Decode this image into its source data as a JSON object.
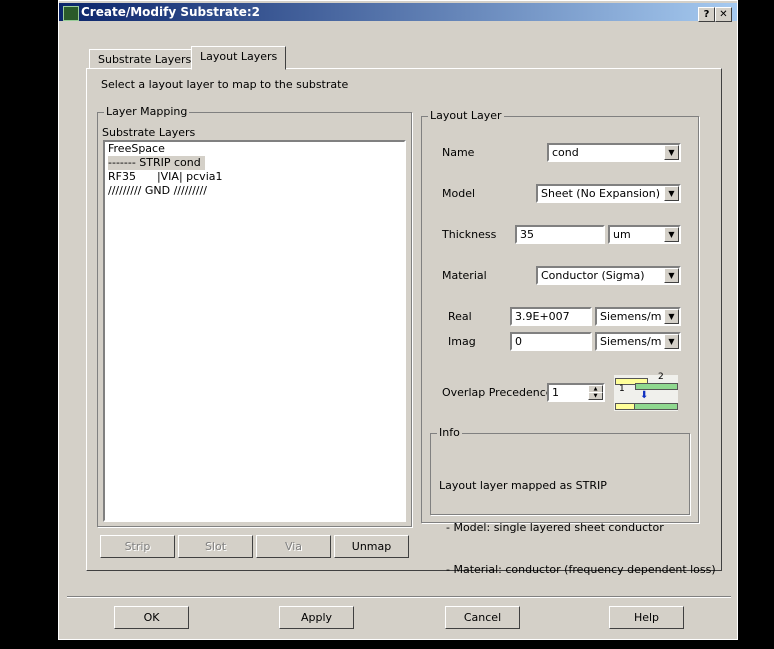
{
  "window": {
    "title": "Create/Modify Substrate:2",
    "help_btn": "?",
    "close_btn": "✕"
  },
  "tabs": [
    {
      "label": "Substrate Layers"
    },
    {
      "label": "Layout Layers"
    }
  ],
  "instruction": "Select a layout layer to map to the substrate",
  "layer_mapping": {
    "group": "Layer Mapping",
    "list_label": "Substrate Layers",
    "items": [
      "FreeSpace",
      "------- STRIP cond",
      "RF35      |VIA| pcvia1",
      "///////// GND /////////"
    ],
    "buttons": {
      "strip": "Strip",
      "slot": "Slot",
      "via": "Via",
      "unmap": "Unmap"
    }
  },
  "layout_layer": {
    "group": "Layout Layer",
    "name_label": "Name",
    "name_value": "cond",
    "model_label": "Model",
    "model_value": "Sheet (No Expansion)",
    "thickness_label": "Thickness",
    "thickness_value": "35",
    "thickness_unit": "um",
    "material_label": "Material",
    "material_value": "Conductor (Sigma)",
    "real_label": "Real",
    "real_value": "3.9E+007",
    "real_unit": "Siemens/m",
    "imag_label": "Imag",
    "imag_value": "0",
    "imag_unit": "Siemens/m",
    "overlap_label": "Overlap Precedence",
    "overlap_value": "1",
    "diagram_1": "1",
    "diagram_2": "2"
  },
  "info": {
    "group": "Info",
    "lines": [
      "Layout layer mapped as STRIP",
      "  - Model: single layered sheet conductor",
      "  - Material: conductor (frequency dependent loss)"
    ]
  },
  "footer": {
    "ok": "OK",
    "apply": "Apply",
    "cancel": "Cancel",
    "help": "Help"
  }
}
